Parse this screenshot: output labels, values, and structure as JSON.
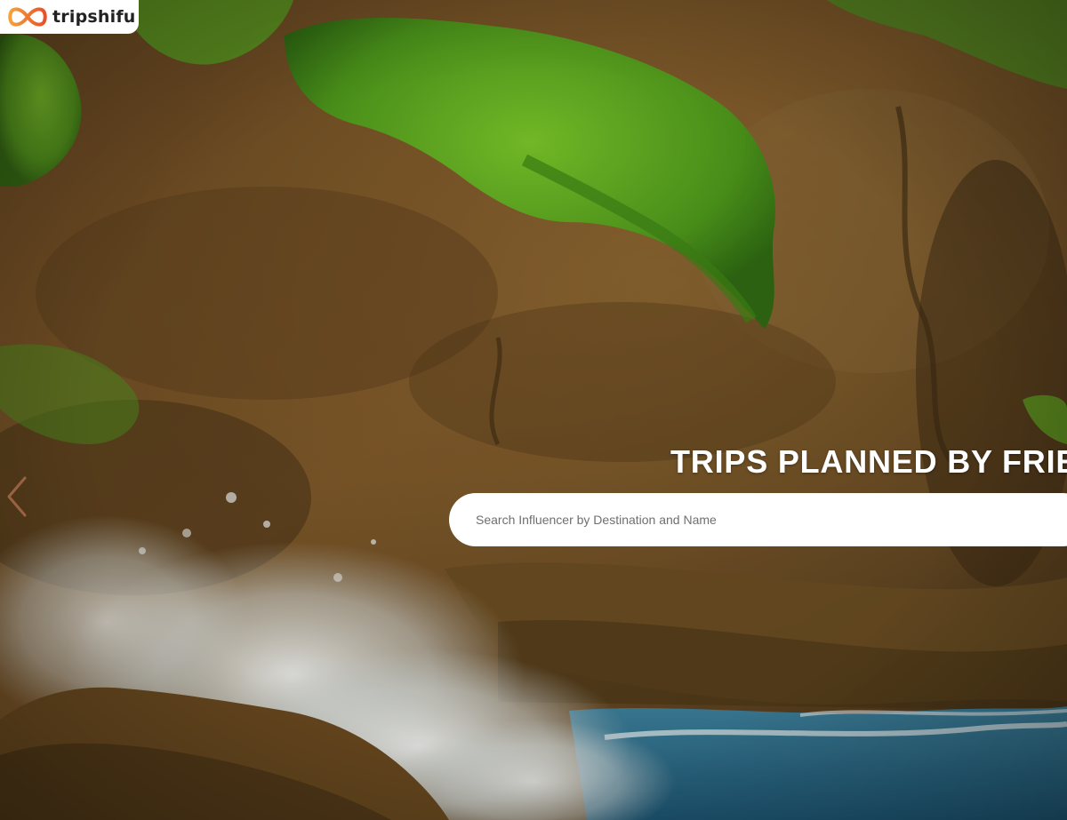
{
  "brand": {
    "name": "tripshifu",
    "colors": {
      "logo_gradient_start": "#f5a23a",
      "logo_gradient_end": "#e8502a",
      "logo_text": "#222222"
    }
  },
  "hero": {
    "title": "TRIPS PLANNED BY FRIENDS",
    "search": {
      "placeholder": "Search Influencer by Destination and Name",
      "value": ""
    },
    "carousel": {
      "prev_icon": "chevron-left-icon"
    },
    "background": "coastal cliff with green shrubs and crashing ocean waves"
  }
}
